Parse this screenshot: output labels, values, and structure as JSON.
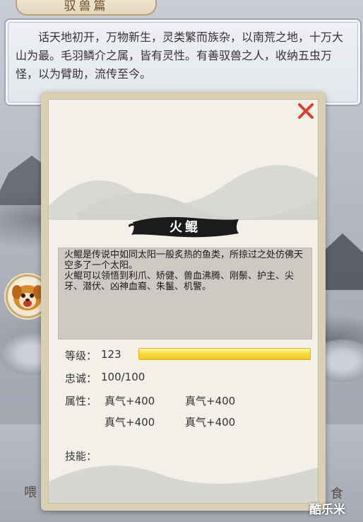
{
  "header": {
    "title": "驭兽篇"
  },
  "intro": {
    "text": "话天地初开，万物新生，灵类繁而族杂，以南荒之地，十万大山为最。毛羽鳞介之属，皆有灵性。有善驭兽之人，收纳五虫万怪，以为臂助，流传至今。"
  },
  "beast": {
    "name": "火鲲",
    "description": "火鲲是传说中如同太阳一般炙热的鱼类，所掠过之处仿佛天空多了一个太阳。\n火鲲可以领悟到利爪、矫健、兽血沸腾、刚鬃、护主、尖牙、潜伏、凶神血裔、朱鬣、机警。",
    "level_label": "等级：",
    "level": "123",
    "level_progress": 1.0,
    "loyalty_label": "忠诚：",
    "loyalty": "100/100",
    "attr_label": "属性：",
    "attributes": [
      "真气+400",
      "真气+400",
      "真气+400",
      "真气+400"
    ],
    "skills_label": "技能："
  },
  "side_glyphs": {
    "left": "喂",
    "right": "食"
  },
  "watermark": "酷乐米",
  "colors": {
    "close": "#d8432b",
    "level_bar": "#f3c524",
    "banner": "#1b1b1b"
  },
  "icons": {
    "close": "close-icon",
    "avatar": "lion-dog-beast-avatar"
  }
}
